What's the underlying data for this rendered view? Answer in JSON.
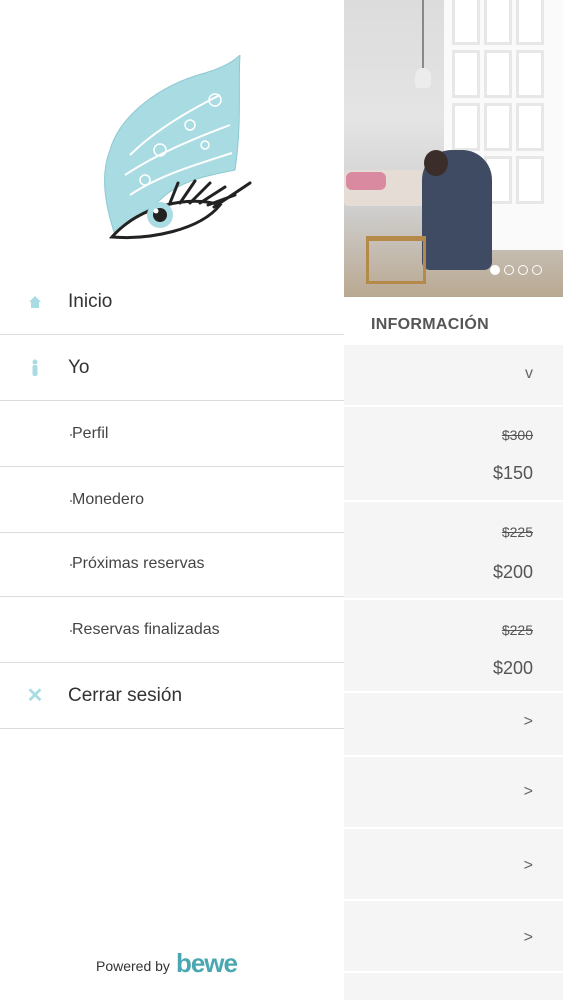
{
  "drawer": {
    "menu": [
      {
        "label": "Inicio",
        "icon": "home-icon"
      },
      {
        "label": "Yo",
        "icon": "person-icon"
      },
      {
        "label": "Perfil",
        "icon": "bullet"
      },
      {
        "label": "Monedero",
        "icon": "bullet"
      },
      {
        "label": "Próximas reservas",
        "icon": "bullet"
      },
      {
        "label": "Reservas finalizadas",
        "icon": "bullet"
      },
      {
        "label": "Cerrar sesión",
        "icon": "close-icon"
      }
    ],
    "powered_by": "Powered by",
    "brand": "bewe",
    "accent_color": "#a9dbe2",
    "brand_color": "#4aa7b1"
  },
  "background": {
    "carousel": {
      "total": 4,
      "active": 1
    },
    "section_title": "INFORMACIÓN",
    "services": [
      {
        "old_price": "$300",
        "price": "$150"
      },
      {
        "old_price": "$225",
        "price": "$200"
      },
      {
        "old_price": "$225",
        "price": "$200"
      }
    ],
    "chevron_down": "v",
    "chevron_right": ">"
  }
}
